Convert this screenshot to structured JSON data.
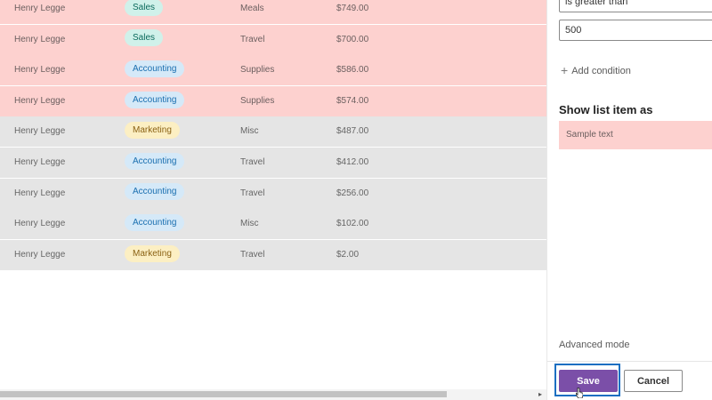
{
  "list": {
    "rows": [
      {
        "name": "Henry Legge",
        "department": "Sales",
        "category": "Meals",
        "amount": "$749.00",
        "highlighted": true
      },
      {
        "name": "Henry Legge",
        "department": "Sales",
        "category": "Travel",
        "amount": "$700.00",
        "highlighted": true
      },
      {
        "name": "Henry Legge",
        "department": "Accounting",
        "category": "Supplies",
        "amount": "$586.00",
        "highlighted": true
      },
      {
        "name": "Henry Legge",
        "department": "Accounting",
        "category": "Supplies",
        "amount": "$574.00",
        "highlighted": true
      },
      {
        "name": "Henry Legge",
        "department": "Marketing",
        "category": "Misc",
        "amount": "$487.00",
        "highlighted": false
      },
      {
        "name": "Henry Legge",
        "department": "Accounting",
        "category": "Travel",
        "amount": "$412.00",
        "highlighted": false
      },
      {
        "name": "Henry Legge",
        "department": "Accounting",
        "category": "Travel",
        "amount": "$256.00",
        "highlighted": false
      },
      {
        "name": "Henry Legge",
        "department": "Accounting",
        "category": "Misc",
        "amount": "$102.00",
        "highlighted": false
      },
      {
        "name": "Henry Legge",
        "department": "Marketing",
        "category": "Travel",
        "amount": "$2.00",
        "highlighted": false
      }
    ]
  },
  "panel": {
    "operator": "is greater than",
    "value": "500",
    "add_condition_label": "Add condition",
    "show_as_title": "Show list item as",
    "sample_text": "Sample text",
    "advanced_mode_label": "Advanced mode",
    "save_label": "Save",
    "cancel_label": "Cancel"
  },
  "colors": {
    "highlight_row": "#fdd1cf",
    "plain_row": "#e5e5e5",
    "save_button": "#7b4fa8",
    "focus_outline": "#1c6fc2"
  }
}
